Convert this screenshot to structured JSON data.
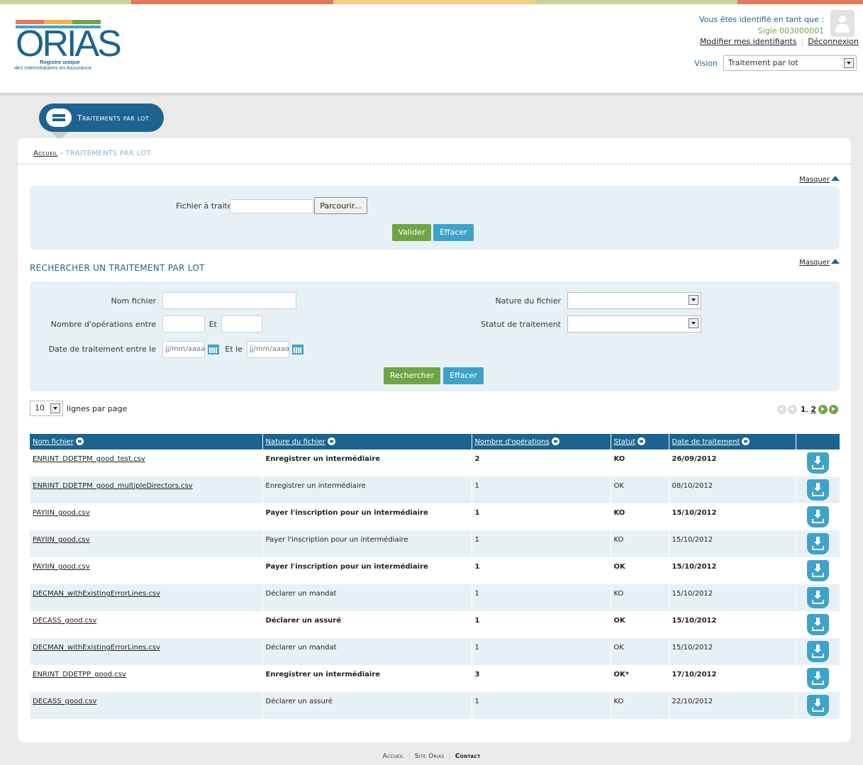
{
  "colors": {
    "primary": "#1c6390",
    "green": "#6ea646",
    "blue": "#3ea3c9",
    "stripe": [
      "#c9d39a",
      "#e07b5b",
      "#f4cf88",
      "#c9d39a",
      "#e07b5b"
    ],
    "logo_bars": [
      "#e07b5b",
      "#f2b441",
      "#6ea646",
      "#3ea3c9"
    ]
  },
  "header": {
    "logo_text": "ORIAS",
    "logo_sub1": "Registre unique",
    "logo_sub2": "des Intermédiaires en Assurance",
    "identified_as": "Vous êtes identifié en tant que :",
    "sigle": "Sigle 003000001",
    "modify_link": "Modifier mes identifiants",
    "logout_link": "Déconnexion",
    "vision_label": "Vision",
    "vision_value": "Traitement par lot"
  },
  "pill": {
    "label": "Traitements par lot"
  },
  "breadcrumb": {
    "home": "Accueil",
    "sep": "›",
    "current": "TRAITEMENTS PAR LOT"
  },
  "masquer": "Masquer",
  "upload": {
    "file_label": "Fichier à traiter",
    "browse_button": "Parcourir...",
    "validate_button": "Valider",
    "clear_button": "Effacer"
  },
  "search": {
    "title": "RECHERCHER UN TRAITEMENT PAR LOT",
    "nom_fichier_label": "Nom fichier",
    "nb_ops_label": "Nombre d'opérations entre",
    "et_label": "Et",
    "date_label": "Date de traitement entre le",
    "et_le_label": "Et le",
    "date_placeholder": "jj/mm/aaaa",
    "nature_label": "Nature du fichier",
    "statut_label": "Statut de traitement",
    "search_button": "Rechercher",
    "clear_button": "Effacer"
  },
  "lines_per_page": {
    "value": "10",
    "label": "lignes par page"
  },
  "pager": {
    "page1": "1",
    "sep": ",",
    "page2": "2"
  },
  "table": {
    "headers": [
      "Nom fichier",
      "Nature du fichier",
      "Nombre d'opérations",
      "Statut",
      "Date de traitement"
    ],
    "rows": [
      {
        "file": "ENRINT_DDETPM_good_test.csv",
        "nature": "Enregistrer un intermédiaire",
        "ops": "2",
        "status": "KO",
        "date": "26/09/2012",
        "bold": true
      },
      {
        "file": "ENRINT_DDETPM_good_multipleDirectors.csv",
        "nature": "Enregistrer un intermédiaire",
        "ops": "1",
        "status": "OK",
        "date": "08/10/2012",
        "bold": false
      },
      {
        "file": "PAYIIN_good.csv",
        "nature": "Payer l'inscription pour un intermédiaire",
        "ops": "1",
        "status": "KO",
        "date": "15/10/2012",
        "bold": true
      },
      {
        "file": "PAYIIN_good.csv",
        "nature": "Payer l'inscription pour un intermédiaire",
        "ops": "1",
        "status": "KO",
        "date": "15/10/2012",
        "bold": false
      },
      {
        "file": "PAYIIN_good.csv",
        "nature": "Payer l'inscription pour un intermédiaire",
        "ops": "1",
        "status": "OK",
        "date": "15/10/2012",
        "bold": true
      },
      {
        "file": "DECMAN_withExistingErrorLines.csv",
        "nature": "Déclarer un mandat",
        "ops": "1",
        "status": "KO",
        "date": "15/10/2012",
        "bold": false
      },
      {
        "file": "DECASS_good.csv",
        "nature": "Déclarer un assuré",
        "ops": "1",
        "status": "OK",
        "date": "15/10/2012",
        "bold": true
      },
      {
        "file": "DECMAN_withExistingErrorLines.csv",
        "nature": "Déclarer un mandat",
        "ops": "1",
        "status": "OK",
        "date": "15/10/2012",
        "bold": false
      },
      {
        "file": "ENRINT_DDETPP_good.csv",
        "nature": "Enregistrer un intermédiaire",
        "ops": "3",
        "status": "OK*",
        "date": "17/10/2012",
        "bold": true
      },
      {
        "file": "DECASS_good.csv",
        "nature": "Déclarer un assuré",
        "ops": "1",
        "status": "KO",
        "date": "22/10/2012",
        "bold": false
      }
    ]
  },
  "footer": {
    "home": "Accueil",
    "site": "Site Orias",
    "contact": "Contact"
  }
}
